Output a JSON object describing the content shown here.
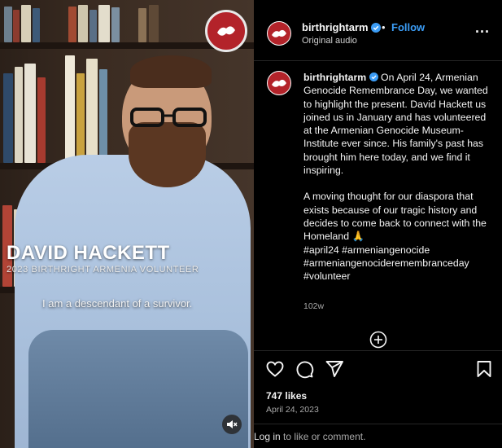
{
  "video": {
    "name_overlay": "DAVID HACKETT",
    "role_overlay": "2023 BIRTHRIGHT ARMENIA VOLUNTEER",
    "subtitle_caption": "I am a descendant of a survivor."
  },
  "header": {
    "username": "birthrightarm",
    "separator": "•",
    "follow_label": "Follow",
    "audio_label": "Original audio",
    "more_label": "..."
  },
  "caption": {
    "username": "birthrightarm",
    "paragraph1": "On April 24, Armenian Genocide Remembrance Day, we wanted to highlight the present. David Hackett us joined us in January and has volunteered at the Armenian Genocide Museum-Institute ever since. His family's past has brought him here today, and we find it inspiring.",
    "paragraph2": "A moving thought for our diaspora that exists because of our tragic history and decides to come back to connect with the Homeland 🙏",
    "hashtags": "#april24 #armeniangenocide #armeniangenocideremembranceday #volunteer",
    "time_ago": "102w"
  },
  "engagement": {
    "likes": "747 likes",
    "date": "April 24, 2023",
    "login_link": "Log in",
    "login_suffix": " to like or comment."
  },
  "colors": {
    "follow_blue": "#3b9cf5",
    "verified_blue": "#3b9cf5",
    "brand_red": "#b3232a",
    "background": "#000000"
  },
  "icons": [
    "like-heart-icon",
    "comment-icon",
    "share-icon",
    "save-bookmark-icon",
    "add-comment-plus-icon",
    "muted-speaker-icon",
    "verified-badge-icon",
    "more-options-icon"
  ]
}
